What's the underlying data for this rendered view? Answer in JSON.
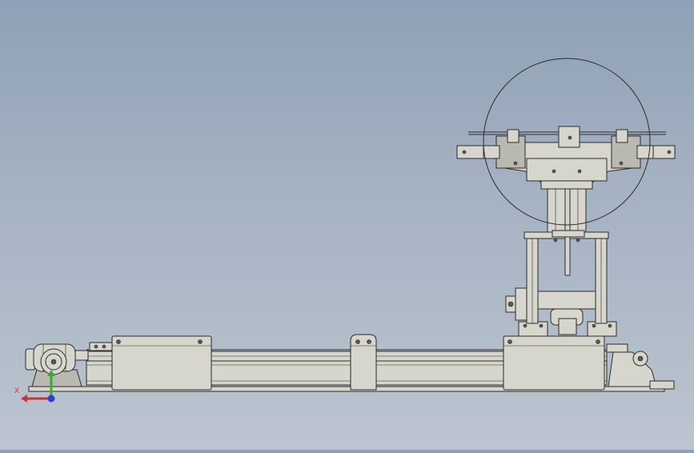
{
  "viewport": {
    "background_top": "#8fa1b6",
    "background_bottom": "#bcc5d0",
    "model_fill": "#d6d6cd",
    "model_stroke": "#2b2b2b"
  },
  "triad": {
    "x_label": "X",
    "x_color": "#d0312d",
    "y_color": "#2fb12f",
    "z_color": "#2f3fd6"
  }
}
